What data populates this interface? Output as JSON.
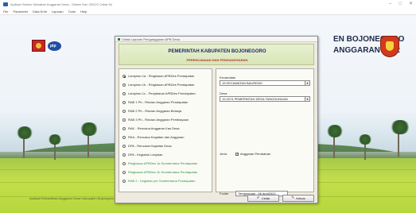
{
  "app": {
    "title": "Aplikasi Sistem Sebaikan Anggaran Desa - Sistem Kan 2022/2 Cetak Kk",
    "window_controls": [
      "–",
      "□",
      "✕"
    ]
  },
  "menu": [
    "File",
    "Parameter",
    "Data Entri",
    "Laporan",
    "Tools",
    "Help"
  ],
  "background": {
    "banner_line1": "EN BOJONEGORO",
    "banner_line2": "ANGGARAN 2022",
    "pip_logo_text": "pip",
    "footer": "Aplikasi Rehabilitasi Anggaran Desa Kabupaten Bojonegoro Tahun Anggaran 2022"
  },
  "dialog": {
    "title": "Cetak Laporan Penganggaran APB Desa",
    "header_title": "PEMERINTAH KABUPATEN BOJONEGORO",
    "header_subtitle": "PERENCANAAN DAN PENGANGGARAN",
    "options": [
      {
        "label": "Lampiran 1a - Ringkasan APBDes Pendapatan",
        "selected": true,
        "green": false
      },
      {
        "label": "Lampiran 1b - Ringkasan APBDes Pendapatan",
        "selected": false,
        "green": false
      },
      {
        "label": "Lampiran 1c - Penjabaran APBDes Pendapatan",
        "selected": false,
        "green": false
      },
      {
        "label": "RAB 1 Pb - Rincian Anggaran Pendapatan",
        "selected": false,
        "green": false
      },
      {
        "label": "RAB 2 Pb - Rincian Anggaran Belanja",
        "selected": false,
        "green": false
      },
      {
        "label": "RAB 3 Pb - Rincian Anggaran Pembiayaan",
        "selected": false,
        "green": false
      },
      {
        "label": "RAK - Rencana Anggaran Kas Desa",
        "selected": false,
        "green": false
      },
      {
        "label": "RKA - Rencana Kegiatan dan Anggaran",
        "selected": false,
        "green": false
      },
      {
        "label": "DPA - Rencana Kegiatan Desa",
        "selected": false,
        "green": false
      },
      {
        "label": "DPA - Kegiatan Lanjutan",
        "selected": false,
        "green": false
      },
      {
        "label": "Ringkasan APBDes 1a Sumberdana Pendapatan",
        "selected": false,
        "green": true
      },
      {
        "label": "Ringkasan APBDes 1b Sumberdana Pendapatan",
        "selected": false,
        "green": true
      },
      {
        "label": "RAB 2 - Kegiatan per Sumberdana Pendapatan",
        "selected": false,
        "green": true
      }
    ],
    "kecamatan_label": "Kecamatan",
    "kecamatan_value": "19 KECAMATAN BAURENO",
    "desa_label": "Desa",
    "desa_value": "19.2074  PEMERINTAH DESA TANGGUNGAN",
    "jenis_label": "Jenis",
    "jenis_checkbox_label": "Anggaran Perubahan",
    "jenis_checked": true,
    "footer_label": "Footer",
    "footer_value": "Tanggungan , 06 April2022",
    "cetak_label": "Cetak",
    "keluar_label": "Keluar"
  },
  "colors": {
    "header_title": "#1c2a66",
    "header_subtitle": "#b0332a",
    "green_option": "#2f8f3a",
    "field": "#b6d73c"
  }
}
